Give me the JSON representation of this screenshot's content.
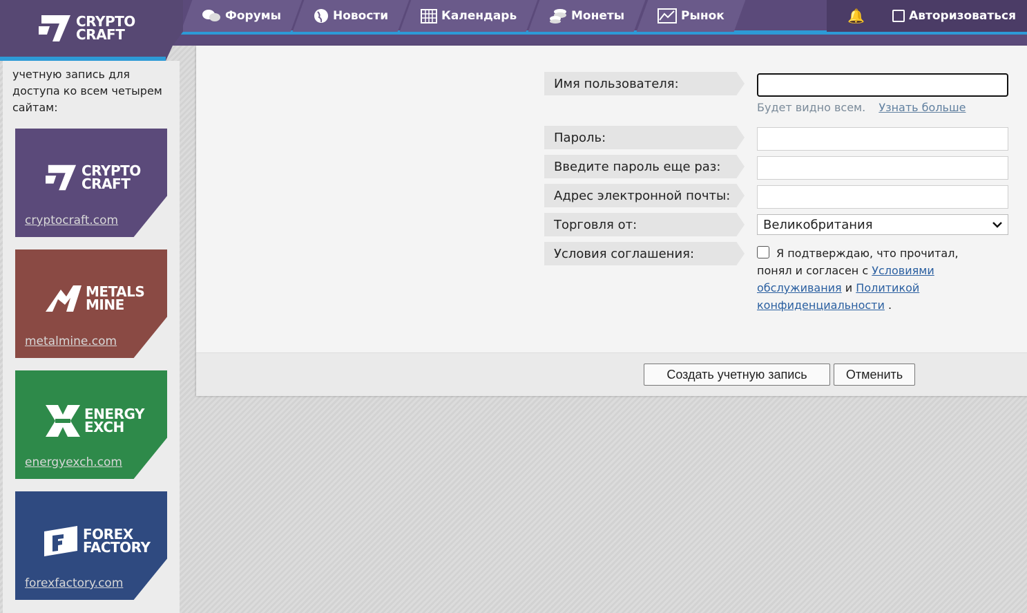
{
  "header": {
    "logo_line1": "CRYPTO",
    "logo_line2": "CRAFT",
    "nav": [
      {
        "label": "Форумы",
        "icon": "chat-bubbles-icon"
      },
      {
        "label": "Новости",
        "icon": "globe-icon"
      },
      {
        "label": "Календарь",
        "icon": "calendar-icon"
      },
      {
        "label": "Монеты",
        "icon": "coins-icon"
      },
      {
        "label": "Рынок",
        "icon": "chart-icon"
      }
    ],
    "login_label": "Авторизоваться"
  },
  "sidebar": {
    "intro": "учетную запись для доступа ко всем четырем сайтам:",
    "sites": [
      {
        "line1": "CRYPTO",
        "line2": "CRAFT",
        "link": "cryptocraft.com",
        "color": "#5b4a7a"
      },
      {
        "line1": "METALS",
        "line2": "MINE",
        "link": "metalmine.com",
        "color": "#8a4a44"
      },
      {
        "line1": "ENERGY",
        "line2": "EXCH",
        "link": "energyexch.com",
        "color": "#2e8a4a"
      },
      {
        "line1": "FOREX",
        "line2": "FACTORY",
        "link": "forexfactory.com",
        "color": "#2f4a80"
      }
    ]
  },
  "form": {
    "username_label": "Имя пользователя:",
    "username_value": "",
    "username_hint": "Будет видно всем.",
    "username_hint_link": "Узнать больше",
    "password_label": "Пароль:",
    "password_repeat_label": "Введите пароль еще раз:",
    "email_label": "Адрес электронной почты:",
    "trade_from_label": "Торговля от:",
    "trade_from_value": "Великобритания",
    "agreement_label": "Условия соглашения:",
    "agreement_text1": "Я подтверждаю, что прочитал, понял и согласен с",
    "agreement_link1": "Условиями обслуживания",
    "agreement_and": "и",
    "agreement_link2": "Политикой конфиденциальности",
    "agreement_end": ".",
    "agreement_checked": false,
    "create_button": "Создать учетную запись",
    "cancel_button": "Отменить"
  }
}
